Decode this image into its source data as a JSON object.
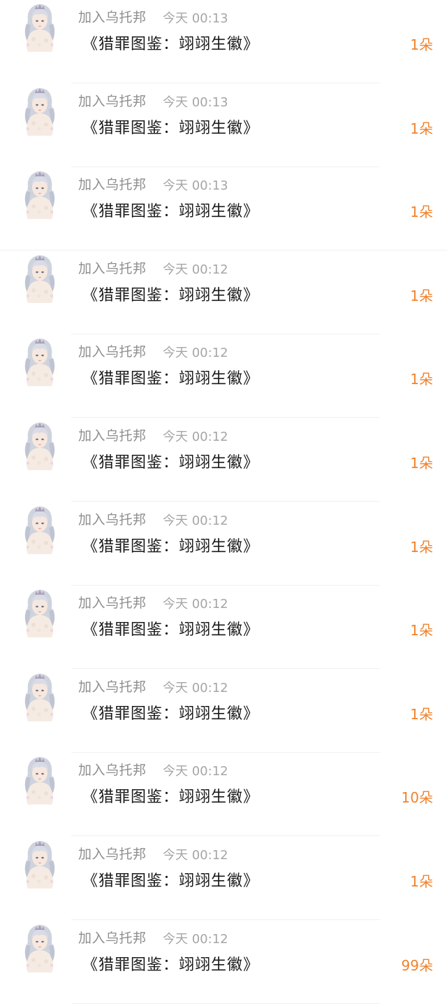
{
  "rows": [
    {
      "name": "加入乌托邦",
      "time": "今天 00:13",
      "title": "《猎罪图鉴：翊翊生徽》",
      "amount": "1朵"
    },
    {
      "name": "加入乌托邦",
      "time": "今天 00:13",
      "title": "《猎罪图鉴：翊翊生徽》",
      "amount": "1朵"
    },
    {
      "name": "加入乌托邦",
      "time": "今天 00:13",
      "title": "《猎罪图鉴：翊翊生徽》",
      "amount": "1朵"
    },
    {
      "name": "加入乌托邦",
      "time": "今天 00:12",
      "title": "《猎罪图鉴：翊翊生徽》",
      "amount": "1朵"
    },
    {
      "name": "加入乌托邦",
      "time": "今天 00:12",
      "title": "《猎罪图鉴：翊翊生徽》",
      "amount": "1朵"
    },
    {
      "name": "加入乌托邦",
      "time": "今天 00:12",
      "title": "《猎罪图鉴：翊翊生徽》",
      "amount": "1朵"
    },
    {
      "name": "加入乌托邦",
      "time": "今天 00:12",
      "title": "《猎罪图鉴：翊翊生徽》",
      "amount": "1朵"
    },
    {
      "name": "加入乌托邦",
      "time": "今天 00:12",
      "title": "《猎罪图鉴：翊翊生徽》",
      "amount": "1朵"
    },
    {
      "name": "加入乌托邦",
      "time": "今天 00:12",
      "title": "《猎罪图鉴：翊翊生徽》",
      "amount": "1朵"
    },
    {
      "name": "加入乌托邦",
      "time": "今天 00:12",
      "title": "《猎罪图鉴：翊翊生徽》",
      "amount": "10朵"
    },
    {
      "name": "加入乌托邦",
      "time": "今天 00:12",
      "title": "《猎罪图鉴：翊翊生徽》",
      "amount": "1朵"
    },
    {
      "name": "加入乌托邦",
      "time": "今天 00:12",
      "title": "《猎罪图鉴：翊翊生徽》",
      "amount": "99朵"
    }
  ],
  "colors": {
    "amount": "#f0822c",
    "name": "#8e8e8e",
    "time": "#a6a6a6",
    "title": "#1a1a1a"
  },
  "icons": {
    "avatar": "avatar-girl-silver-hair"
  }
}
